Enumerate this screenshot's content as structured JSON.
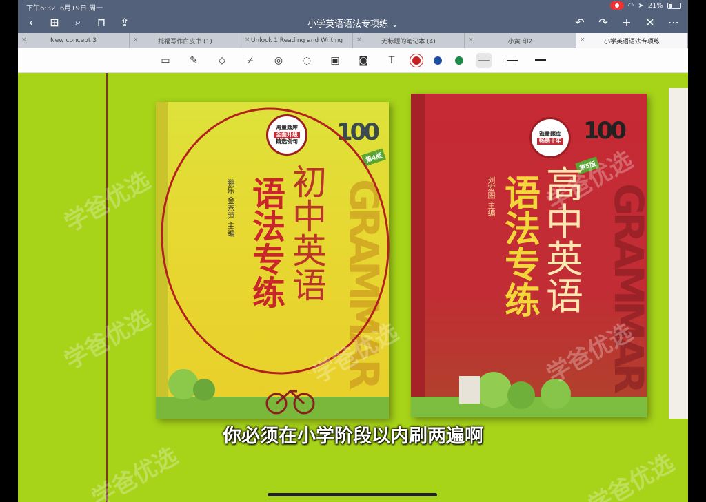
{
  "status_bar": {
    "time": "下午6:32",
    "date": "6月19日 周一",
    "battery": "21%"
  },
  "nav": {
    "title": "小学英语语法专项练",
    "title_chevron": "⌄"
  },
  "tabs": [
    {
      "label": "New concept 3"
    },
    {
      "label": "托福写作白皮书 (1)"
    },
    {
      "label": "Unlock 1 Reading and Writing"
    },
    {
      "label": "无标题的笔记本 (4)"
    },
    {
      "label": "小黄 印2"
    },
    {
      "label": "小学英语语法专项练"
    }
  ],
  "toolbar": {
    "colors": [
      "#c62020",
      "#1f4fa0",
      "#1f8a4a"
    ]
  },
  "book_left": {
    "badge_top": "海量题库",
    "badge_mid": "全面升级",
    "badge_bot": "精选例句",
    "hundred": "100",
    "edition": "第4版",
    "title_chars_a": [
      "语",
      "法",
      "专",
      "练"
    ],
    "title_chars_b": [
      "初",
      "中",
      "英",
      "语"
    ],
    "author": "鹏乐 金燕萍 主编",
    "gram": "GRAMMAR"
  },
  "book_right": {
    "badge_top": "海量题库",
    "badge_mid": "畅销十年",
    "hundred": "100",
    "edition": "第5版",
    "title_chars_a": [
      "语",
      "法",
      "专",
      "练"
    ],
    "title_chars_b": [
      "高",
      "中",
      "英",
      "语"
    ],
    "author": "刘宏图 主编",
    "gram": "GRAMMAR"
  },
  "subtitle": "你必须在小学阶段以内刷两遍啊",
  "watermark": "学爸优选"
}
